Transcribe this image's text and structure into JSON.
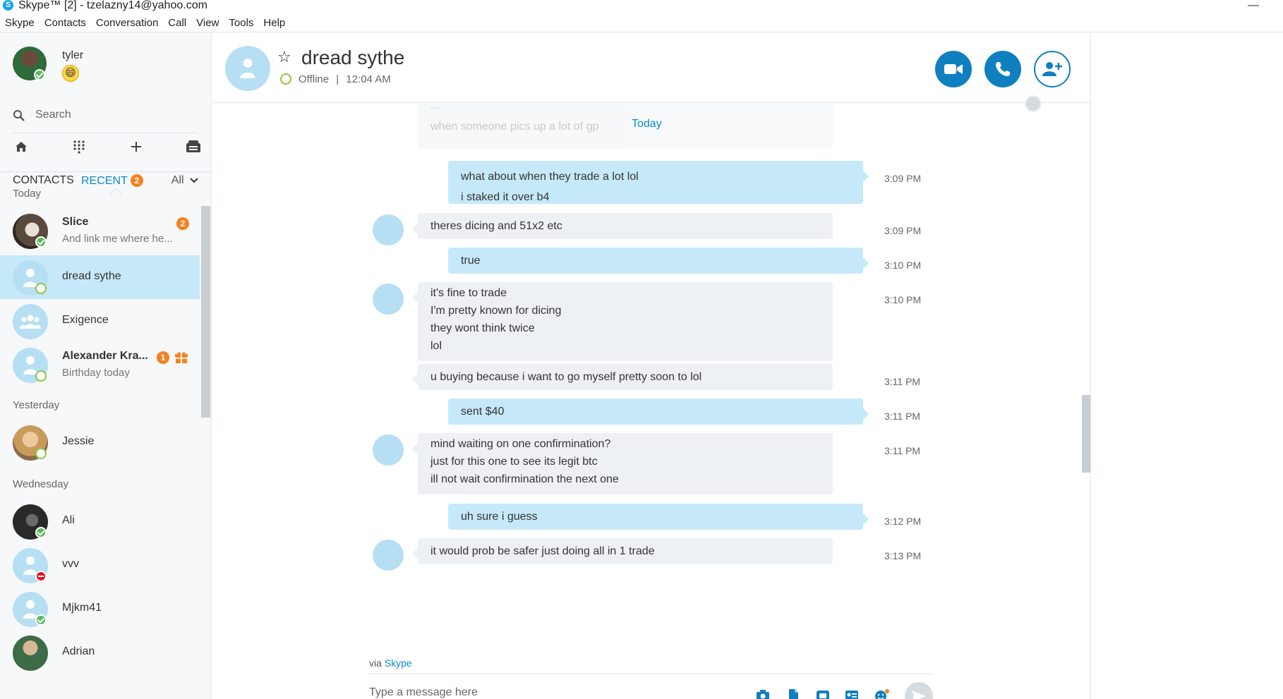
{
  "window": {
    "title": "Skype™ [2] - tzelazny14@yahoo.com",
    "minimize": "—"
  },
  "menu": [
    "Skype",
    "Contacts",
    "Conversation",
    "Call",
    "View",
    "Tools",
    "Help"
  ],
  "profile": {
    "name": "tyler",
    "mood_emoji": "😄"
  },
  "search": {
    "placeholder": "Search"
  },
  "tabs": {
    "contacts": "CONTACTS",
    "recent": "RECENT",
    "recent_count": "2",
    "filter": "All"
  },
  "groups": {
    "today": "Today",
    "yesterday": "Yesterday",
    "wednesday": "Wednesday"
  },
  "contacts": [
    {
      "name": "Slice",
      "preview": "And link me where he...",
      "badge": "2"
    },
    {
      "name": "dread sythe"
    },
    {
      "name": "Exigence"
    },
    {
      "name": "Alexander Kra...",
      "preview": "Birthday today",
      "badge": "1"
    },
    {
      "name": "Jessie"
    },
    {
      "name": "Ali"
    },
    {
      "name": "vvv"
    },
    {
      "name": "Mjkm41"
    },
    {
      "name": "Adrian"
    }
  ],
  "chat": {
    "name": "dread sythe",
    "status": "Offline",
    "status_sep": "|",
    "last_seen": "12:04 AM",
    "today_label": "Today",
    "faded": [
      "...",
      "when someone pics up a lot of gp"
    ],
    "messages": [
      {
        "dir": "out",
        "lines": [
          "what about when they trade a lot lol",
          "i staked it over b4"
        ],
        "time": "3:09 PM"
      },
      {
        "dir": "in",
        "lines": [
          "theres dicing and 51x2 etc"
        ],
        "time": "3:09 PM"
      },
      {
        "dir": "out",
        "lines": [
          "true"
        ],
        "time": "3:10 PM"
      },
      {
        "dir": "in",
        "lines": [
          "it's fine to trade",
          "I'm pretty known for dicing",
          "they wont think twice",
          "lol"
        ],
        "time": "3:10 PM"
      },
      {
        "dir": "in",
        "lines": [
          "u buying because i want to go myself pretty soon to lol"
        ],
        "time": "3:11 PM"
      },
      {
        "dir": "out",
        "lines": [
          "sent $40"
        ],
        "time": "3:11 PM"
      },
      {
        "dir": "in",
        "lines": [
          "mind waiting on one confirmination?",
          "just for this one to see its legit btc",
          "ill not wait confirmination the next one"
        ],
        "time": "3:11 PM"
      },
      {
        "dir": "out",
        "lines": [
          "uh sure i guess"
        ],
        "time": "3:12 PM"
      },
      {
        "dir": "in",
        "lines": [
          "it would prob be safer just doing all in 1 trade"
        ],
        "time": "3:13 PM"
      }
    ],
    "via_prefix": "via",
    "via_link": "Skype",
    "composer_placeholder": "Type a message here"
  },
  "colors": {
    "accent": "#0f8bc9",
    "bubble_out": "#c6e9f9",
    "bubble_in": "#eef1f4",
    "badge": "#f5821f",
    "online": "#5cb85c"
  }
}
